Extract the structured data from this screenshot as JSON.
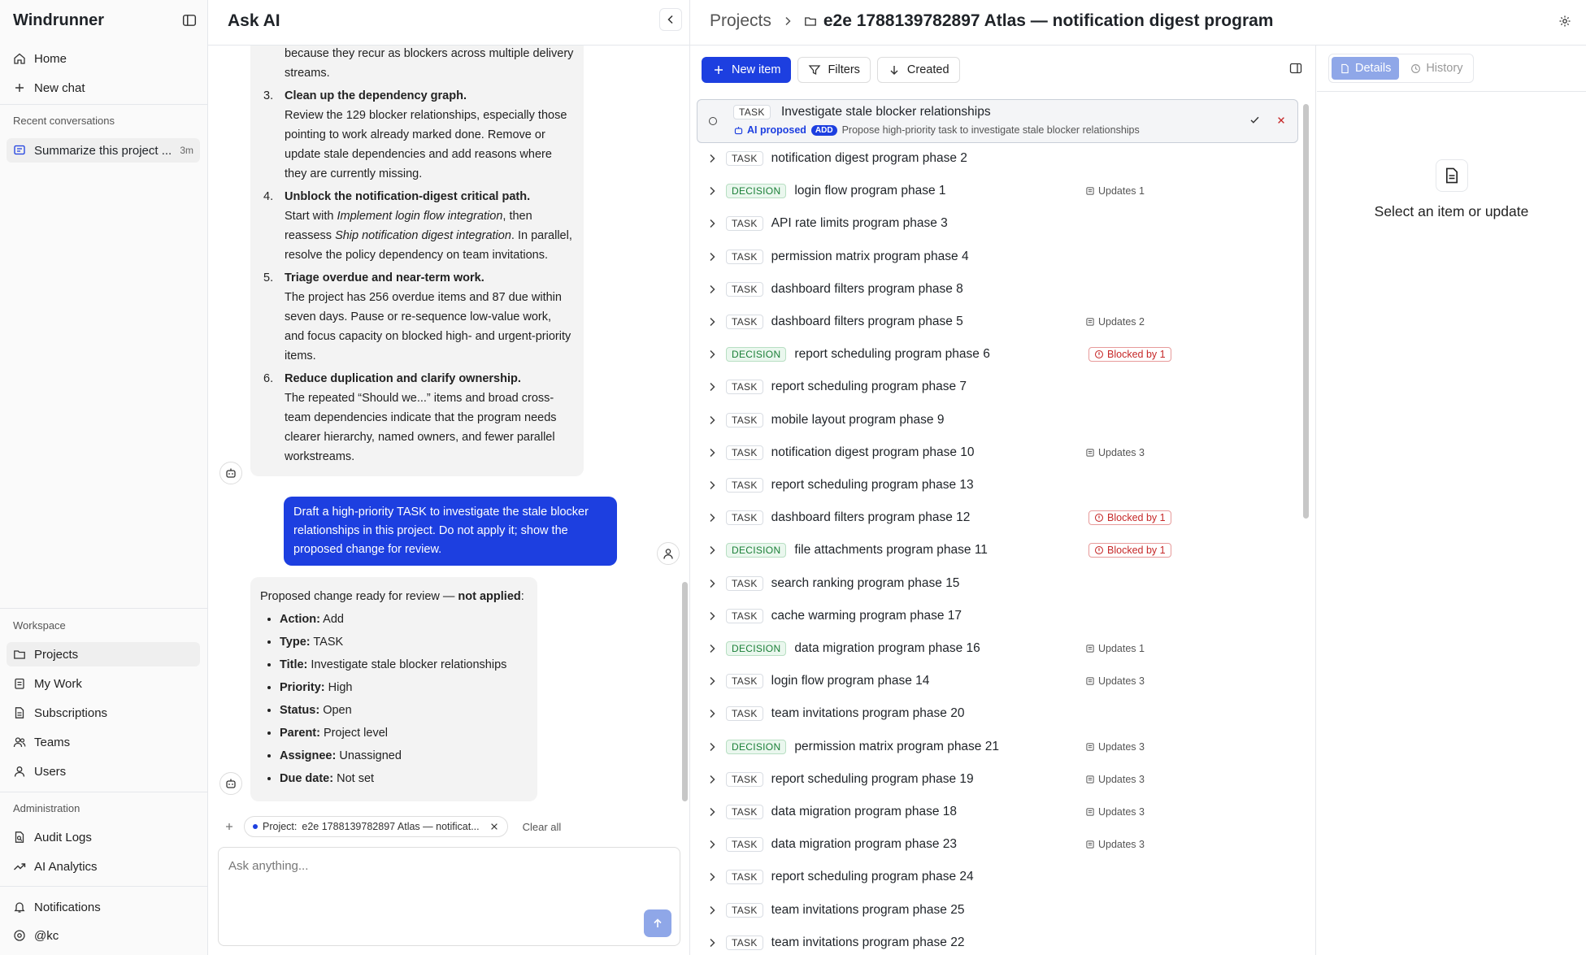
{
  "sidebar": {
    "brand": "Windrunner",
    "nav": {
      "home": "Home",
      "new_chat": "New chat"
    },
    "recent_label": "Recent conversations",
    "recent": {
      "title": "Summarize this project ...",
      "age": "3m"
    },
    "workspace_label": "Workspace",
    "workspace": [
      "Projects",
      "My Work",
      "Subscriptions",
      "Teams",
      "Users"
    ],
    "admin_label": "Administration",
    "admin": [
      "Audit Logs",
      "AI Analytics"
    ],
    "notifications": "Notifications",
    "user": "@kc"
  },
  "chat": {
    "title": "Ask AI",
    "prior_tail": "because they recur as blockers across multiple delivery streams.",
    "steps": [
      {
        "num": "3.",
        "head": "Clean up the dependency graph.",
        "body": "Review the 129 blocker relationships, especially those pointing to work already marked done. Remove or update stale dependencies and add reasons where they are currently missing."
      },
      {
        "num": "4.",
        "head": "Unblock the notification-digest critical path.",
        "body_pre": "Start with ",
        "em1": "Implement login flow integration",
        "body_mid": ", then reassess ",
        "em2": "Ship notification digest integration",
        "body_post": ". In parallel, resolve the policy dependency on team invitations."
      },
      {
        "num": "5.",
        "head": "Triage overdue and near-term work.",
        "body": "The project has 256 overdue items and 87 due within seven days. Pause or re-sequence low-value work, and focus capacity on blocked high- and urgent-priority items."
      },
      {
        "num": "6.",
        "head": "Reduce duplication and clarify ownership.",
        "body": "The repeated “Should we...” items and broad cross-team dependencies indicate that the program needs clearer hierarchy, named owners, and fewer parallel workstreams."
      }
    ],
    "user_msg": "Draft a high-priority TASK to investigate the stale blocker relationships in this project. Do not apply it; show the proposed change for review.",
    "proposal": {
      "intro": "Proposed change ready for review — ",
      "intro_bold": "not applied",
      "intro_end": ":",
      "props": [
        {
          "k": "Action:",
          "v": "Add"
        },
        {
          "k": "Type:",
          "v": "TASK"
        },
        {
          "k": "Title:",
          "v": "Investigate stale blocker relationships"
        },
        {
          "k": "Priority:",
          "v": "High"
        },
        {
          "k": "Status:",
          "v": "Open"
        },
        {
          "k": "Parent:",
          "v": "Project level"
        },
        {
          "k": "Assignee:",
          "v": "Unassigned"
        },
        {
          "k": "Due date:",
          "v": "Not set"
        }
      ]
    },
    "context": {
      "label": "Project:",
      "value": "e2e 1788139782897 Atlas — notificat...",
      "clear": "Clear all"
    },
    "input_placeholder": "Ask anything..."
  },
  "main": {
    "crumb_root": "Projects",
    "crumb_current": "e2e 1788139782897 Atlas — notification digest program",
    "toolbar": {
      "new_item": "New item",
      "filters": "Filters",
      "sort": "Created"
    },
    "proposed": {
      "type": "TASK",
      "title": "Investigate stale blocker relationships",
      "ai_label": "AI proposed",
      "action": "ADD",
      "desc": "Propose high-priority task to investigate stale blocker relationships"
    },
    "rows": [
      {
        "type": "TASK",
        "title": "notification digest program phase 2",
        "meta": ""
      },
      {
        "type": "DECISION",
        "title": "login flow program phase 1",
        "meta": "Updates 1"
      },
      {
        "type": "TASK",
        "title": "API rate limits program phase 3",
        "meta": ""
      },
      {
        "type": "TASK",
        "title": "permission matrix program phase 4",
        "meta": ""
      },
      {
        "type": "TASK",
        "title": "dashboard filters program phase 8",
        "meta": ""
      },
      {
        "type": "TASK",
        "title": "dashboard filters program phase 5",
        "meta": "Updates 2"
      },
      {
        "type": "DECISION",
        "title": "report scheduling program phase 6",
        "blocked": "Blocked by 1"
      },
      {
        "type": "TASK",
        "title": "report scheduling program phase 7",
        "meta": ""
      },
      {
        "type": "TASK",
        "title": "mobile layout program phase 9",
        "meta": ""
      },
      {
        "type": "TASK",
        "title": "notification digest program phase 10",
        "meta": "Updates 3"
      },
      {
        "type": "TASK",
        "title": "report scheduling program phase 13",
        "meta": ""
      },
      {
        "type": "TASK",
        "title": "dashboard filters program phase 12",
        "blocked": "Blocked by 1"
      },
      {
        "type": "DECISION",
        "title": "file attachments program phase 11",
        "blocked": "Blocked by 1"
      },
      {
        "type": "TASK",
        "title": "search ranking program phase 15",
        "meta": ""
      },
      {
        "type": "TASK",
        "title": "cache warming program phase 17",
        "meta": ""
      },
      {
        "type": "DECISION",
        "title": "data migration program phase 16",
        "meta": "Updates 1"
      },
      {
        "type": "TASK",
        "title": "login flow program phase 14",
        "meta": "Updates 3"
      },
      {
        "type": "TASK",
        "title": "team invitations program phase 20",
        "meta": ""
      },
      {
        "type": "DECISION",
        "title": "permission matrix program phase 21",
        "meta": "Updates 3"
      },
      {
        "type": "TASK",
        "title": "report scheduling program phase 19",
        "meta": "Updates 3"
      },
      {
        "type": "TASK",
        "title": "data migration program phase 18",
        "meta": "Updates 3"
      },
      {
        "type": "TASK",
        "title": "data migration program phase 23",
        "meta": "Updates 3"
      },
      {
        "type": "TASK",
        "title": "report scheduling program phase 24",
        "meta": ""
      },
      {
        "type": "TASK",
        "title": "team invitations program phase 25",
        "meta": ""
      },
      {
        "type": "TASK",
        "title": "team invitations program phase 22",
        "meta": ""
      }
    ]
  },
  "details": {
    "tabs": {
      "details": "Details",
      "history": "History"
    },
    "empty": "Select an item or update"
  },
  "colors": {
    "accent": "#1d3fe0",
    "decision": "#1a7f37",
    "blocked": "#c62828"
  }
}
